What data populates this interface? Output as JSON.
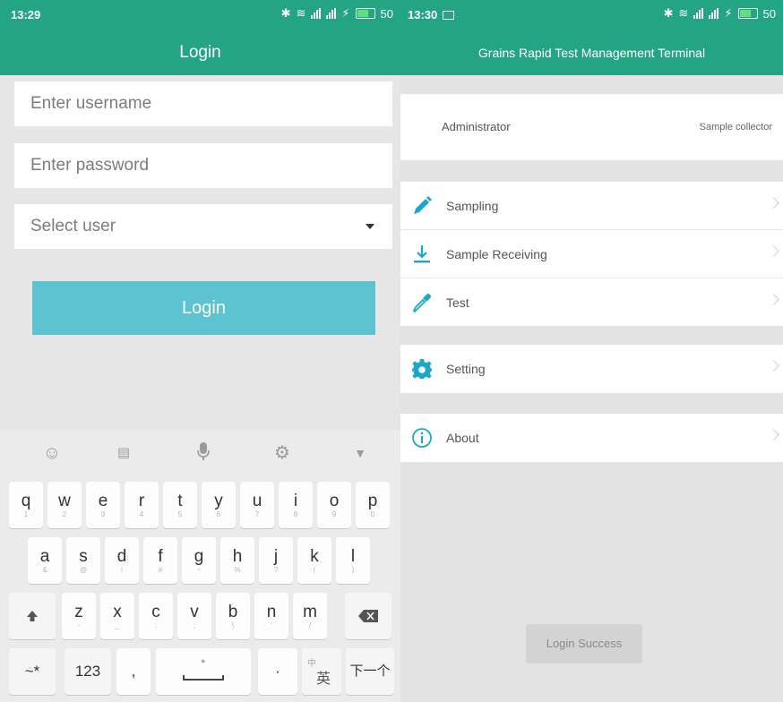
{
  "left_screen": {
    "status": {
      "time": "13:29",
      "battery": "50"
    },
    "title": "Login",
    "username_placeholder": "Enter username",
    "password_placeholder": "Enter password",
    "user_select": "Select user",
    "login_button": "Login",
    "keyboard": {
      "row1": [
        {
          "k": "q",
          "s": "1"
        },
        {
          "k": "w",
          "s": "2"
        },
        {
          "k": "e",
          "s": "3"
        },
        {
          "k": "r",
          "s": "4"
        },
        {
          "k": "t",
          "s": "5"
        },
        {
          "k": "y",
          "s": "6"
        },
        {
          "k": "u",
          "s": "7"
        },
        {
          "k": "i",
          "s": "8"
        },
        {
          "k": "o",
          "s": "9"
        },
        {
          "k": "p",
          "s": "0"
        }
      ],
      "row2": [
        {
          "k": "a",
          "s": "&"
        },
        {
          "k": "s",
          "s": "@"
        },
        {
          "k": "d",
          "s": "!"
        },
        {
          "k": "f",
          "s": "#"
        },
        {
          "k": "g",
          "s": "~"
        },
        {
          "k": "h",
          "s": "%"
        },
        {
          "k": "j",
          "s": "?"
        },
        {
          "k": "k",
          "s": "("
        },
        {
          "k": "l",
          "s": ")"
        }
      ],
      "row3": [
        {
          "k": "z",
          "s": "-"
        },
        {
          "k": "x",
          "s": "_"
        },
        {
          "k": "c",
          "s": ":"
        },
        {
          "k": "v",
          "s": ";"
        },
        {
          "k": "b",
          "s": "\\"
        },
        {
          "k": "n",
          "s": "'"
        },
        {
          "k": "m",
          "s": "/"
        }
      ],
      "symbols_key": "~*",
      "numbers_key": "123",
      "comma_key": ",",
      "period_key": "·",
      "lang_key_small": "中",
      "lang_key_main": "英",
      "next_key": "下一个"
    }
  },
  "right_screen": {
    "status": {
      "time": "13:30",
      "battery": "50"
    },
    "title": "Grains Rapid Test Management Terminal",
    "user": {
      "name": "Administrator",
      "role": "Sample collector"
    },
    "menu": {
      "sampling": "Sampling",
      "receiving": "Sample Receiving",
      "test": "Test",
      "setting": "Setting",
      "about": "About"
    },
    "toast": "Login Success"
  },
  "colors": {
    "header": "#23a584",
    "login_button": "#5ec3d1",
    "menu_icon": "#1aa8c9"
  }
}
